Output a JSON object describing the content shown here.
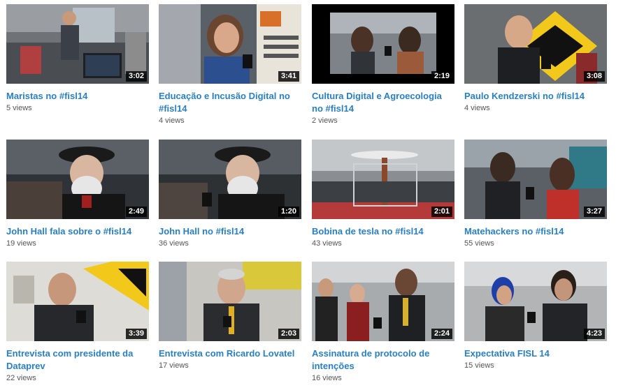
{
  "videos": [
    {
      "title": "Maristas no #fisl14",
      "duration": "3:02",
      "views": "5 views"
    },
    {
      "title": "Educação e Incusão Digital no #fisl14",
      "duration": "3:41",
      "views": "4 views"
    },
    {
      "title": "Cultura Digital e Agroecologia no #fisl14",
      "duration": "2:19",
      "views": "2 views"
    },
    {
      "title": "Paulo Kendzerski no #fisl14",
      "duration": "3:08",
      "views": "4 views"
    },
    {
      "title": "John Hall fala sobre o #fisl14",
      "duration": "2:49",
      "views": "19 views"
    },
    {
      "title": "John Hall no #fisl14",
      "duration": "1:20",
      "views": "36 views"
    },
    {
      "title": "Bobina de tesla no #fisl14",
      "duration": "2:01",
      "views": "43 views"
    },
    {
      "title": "Matehackers no #fisl14",
      "duration": "3:27",
      "views": "55 views"
    },
    {
      "title": "Entrevista com presidente da Dataprev",
      "duration": "3:39",
      "views": "22 views"
    },
    {
      "title": "Entrevista com Ricardo Lovatel",
      "duration": "2:03",
      "views": "17 views"
    },
    {
      "title": "Assinatura de protocolo de intenções",
      "duration": "2:24",
      "views": "16 views"
    },
    {
      "title": "Expectativa FISL 14",
      "duration": "4:23",
      "views": "15 views"
    }
  ],
  "colors": {
    "link": "#2a7fc0",
    "views": "#555555",
    "badge_bg": "#000000"
  }
}
